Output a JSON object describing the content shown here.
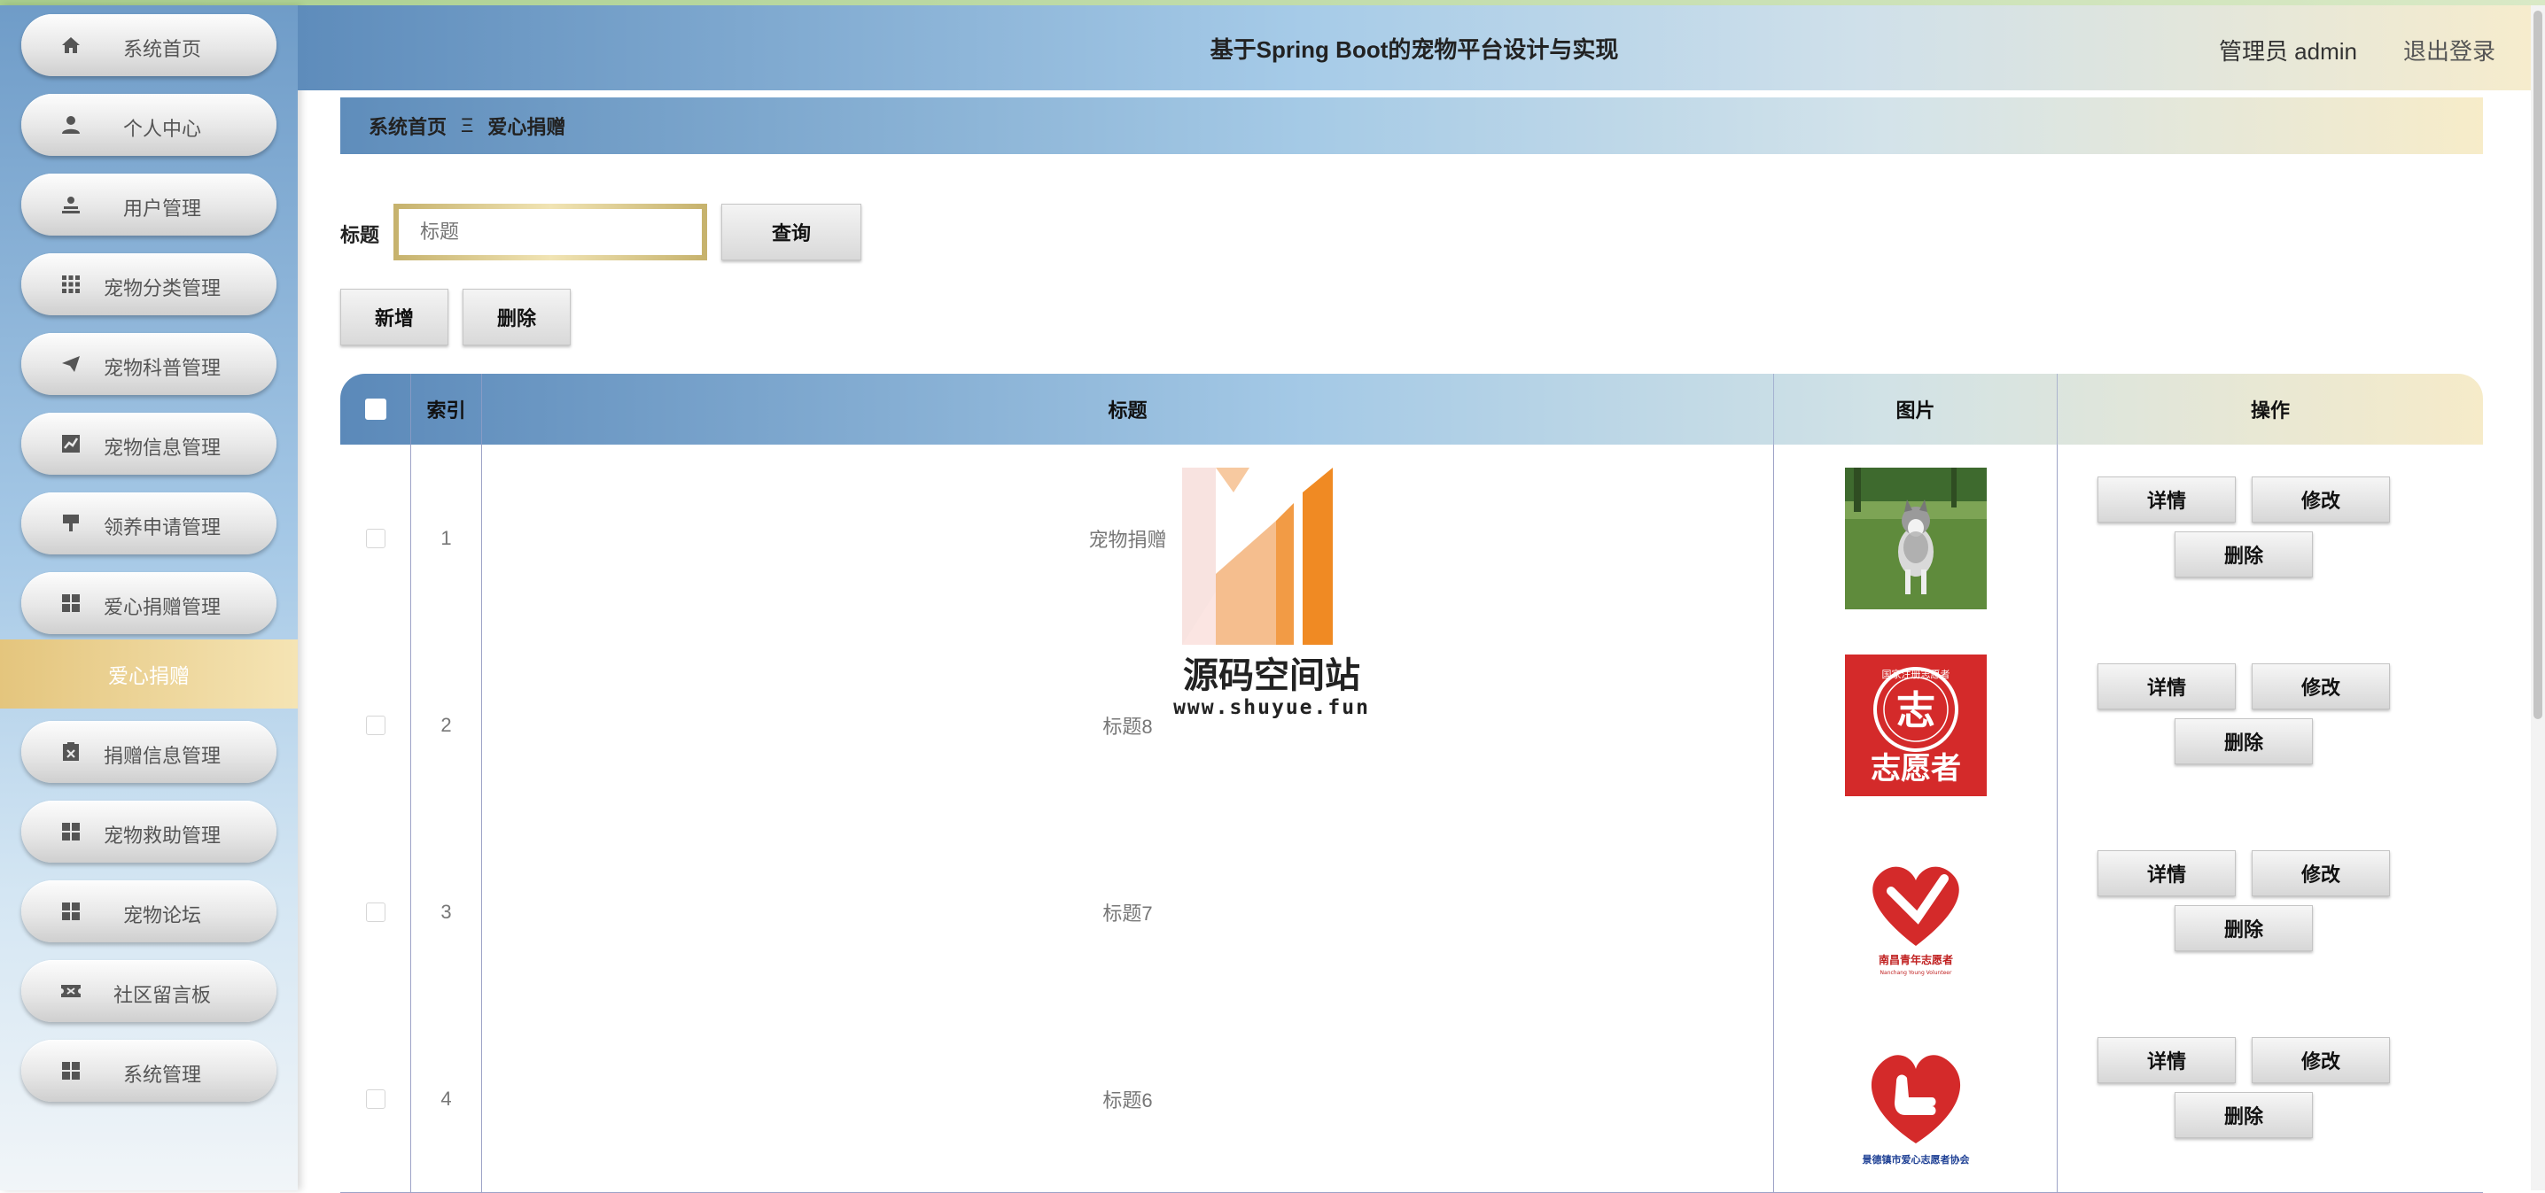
{
  "header": {
    "title": "基于Spring Boot的宠物平台设计与实现",
    "user": "管理员 admin",
    "logout": "退出登录"
  },
  "sidebar": {
    "items": [
      {
        "label": "系统首页",
        "icon": "home-icon"
      },
      {
        "label": "个人中心",
        "icon": "person-icon"
      },
      {
        "label": "用户管理",
        "icon": "user-icon"
      },
      {
        "label": "宠物分类管理",
        "icon": "grid-icon"
      },
      {
        "label": "宠物科普管理",
        "icon": "send-icon"
      },
      {
        "label": "宠物信息管理",
        "icon": "chart-icon"
      },
      {
        "label": "领养申请管理",
        "icon": "stamp-icon"
      },
      {
        "label": "爱心捐赠管理",
        "icon": "apps-icon"
      }
    ],
    "active_sub": "爱心捐赠",
    "items2": [
      {
        "label": "捐赠信息管理",
        "icon": "clipboard-icon"
      },
      {
        "label": "宠物救助管理",
        "icon": "apps-icon"
      },
      {
        "label": "宠物论坛",
        "icon": "apps-icon"
      },
      {
        "label": "社区留言板",
        "icon": "ticket-icon"
      },
      {
        "label": "系统管理",
        "icon": "apps-icon"
      }
    ]
  },
  "breadcrumb": {
    "home": "系统首页",
    "separator": "Ξ",
    "current": "爱心捐赠"
  },
  "search": {
    "label": "标题",
    "placeholder": "标题",
    "button": "查询"
  },
  "actions": {
    "add": "新增",
    "delete": "删除"
  },
  "table": {
    "columns": [
      "索引",
      "标题",
      "图片",
      "操作"
    ],
    "rows": [
      {
        "index": "1",
        "title": "宠物捐赠",
        "image": "husky-photo"
      },
      {
        "index": "2",
        "title": "标题8",
        "image": "volunteer-logo"
      },
      {
        "index": "3",
        "title": "标题7",
        "image": "heart-logo"
      },
      {
        "index": "4",
        "title": "标题6",
        "image": "thumb-heart-logo"
      }
    ],
    "op_labels": {
      "detail": "详情",
      "edit": "修改",
      "delete": "删除"
    }
  },
  "logos": {
    "row2": {
      "top": "国家注册志愿者",
      "main": "志愿者"
    },
    "row3": {
      "caption": "南昌青年志愿者",
      "sub": "Nanchang Young Volunteer"
    },
    "row4": {
      "caption": "景德镇市爱心志愿者协会"
    }
  },
  "watermark": {
    "title": "源码空间站",
    "url": "www.shuyue.fun"
  }
}
